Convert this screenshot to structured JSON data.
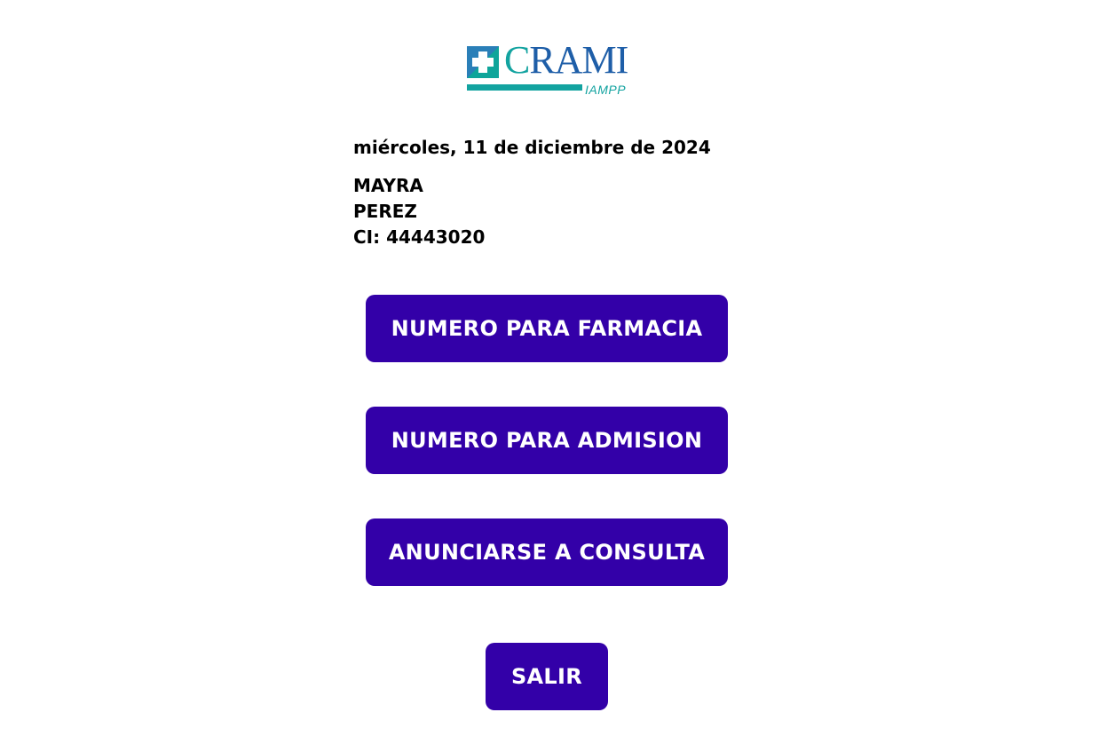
{
  "logo": {
    "brand": "CRAMI",
    "brand_rest": "RAMI",
    "brand_first": "C",
    "subtitle": "IAMPP",
    "icon": "medical-cross-icon",
    "colors": {
      "blue": "#1e5ea8",
      "teal": "#13a3a0"
    }
  },
  "patient": {
    "date": "miércoles, 11 de diciembre de 2024",
    "first_name": "MAYRA",
    "last_name": "PEREZ",
    "ci": "CI: 44443020"
  },
  "actions": {
    "farmacia_label": "NUMERO PARA FARMACIA",
    "admision_label": "NUMERO PARA ADMISION",
    "consulta_label": "ANUNCIARSE A CONSULTA",
    "salir_label": "SALIR"
  },
  "theme": {
    "button_color": "#3300a8",
    "button_text_color": "#ffffff"
  }
}
